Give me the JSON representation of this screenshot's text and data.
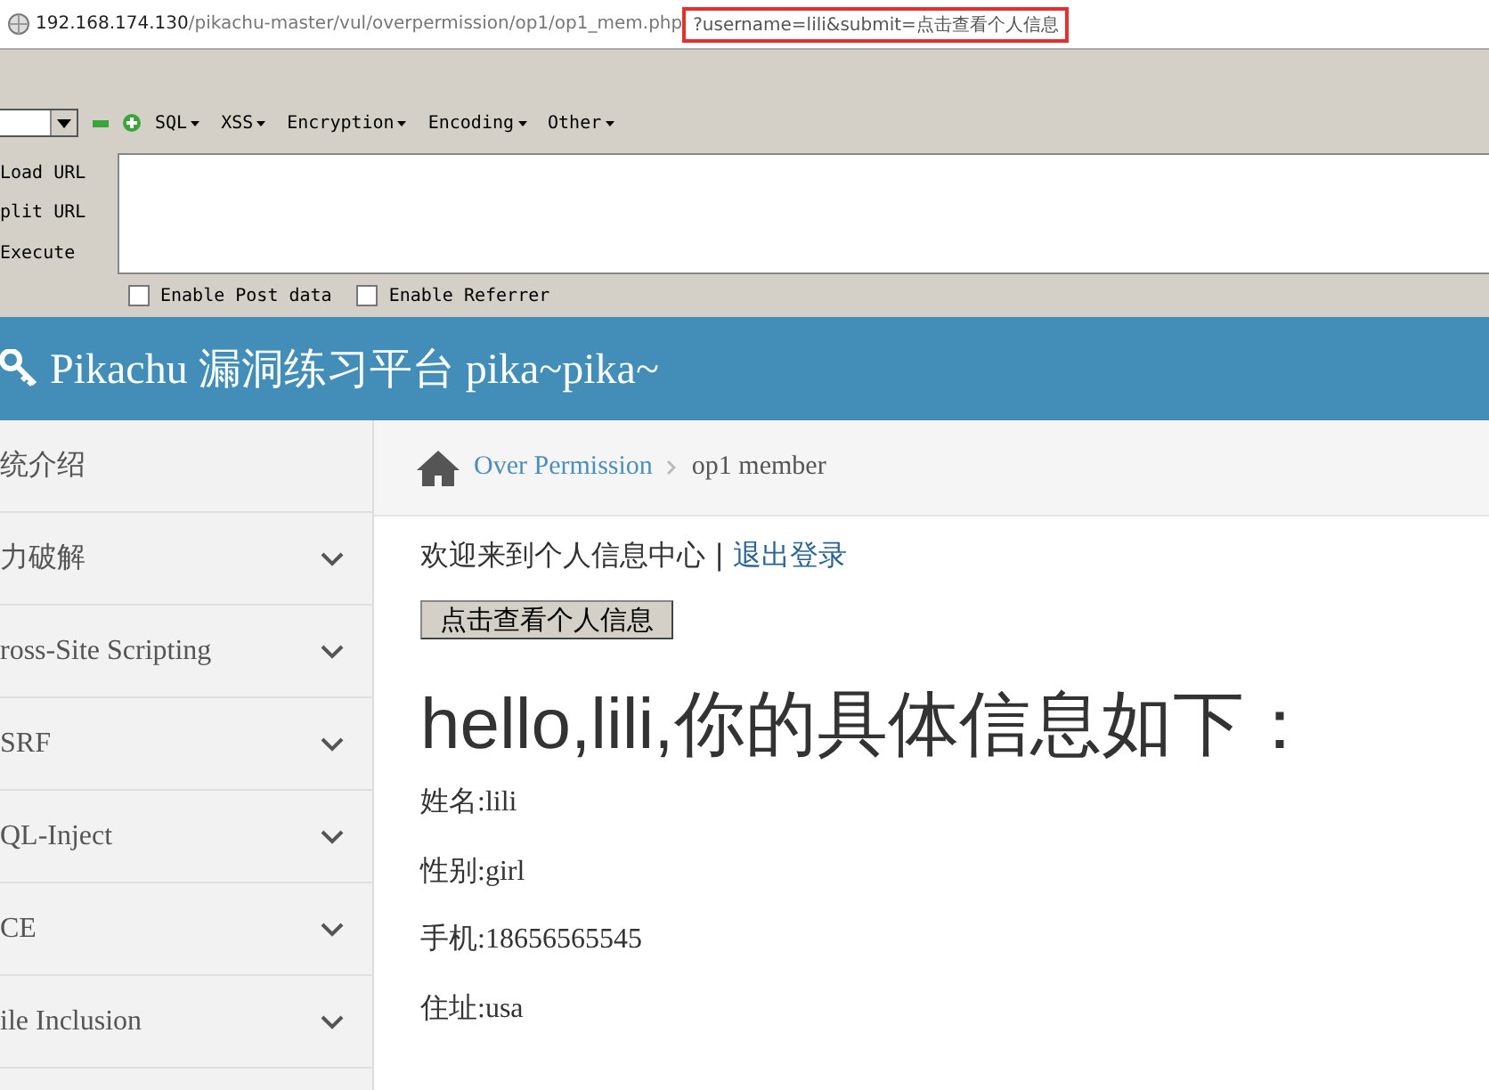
{
  "address_bar": {
    "host": "192.168.174.130",
    "path": "/pikachu-master/vul/overpermission/op1/op1_mem.php",
    "highlighted_query": "?username=lili&submit=点击查看个人信息"
  },
  "hackbar": {
    "menus": [
      {
        "label": "SQL"
      },
      {
        "label": "XSS"
      },
      {
        "label": "Encryption"
      },
      {
        "label": "Encoding"
      },
      {
        "label": "Other"
      }
    ],
    "actions": [
      "Load URL",
      "plit URL",
      "Execute"
    ],
    "options": [
      {
        "label": "Enable Post data",
        "checked": false
      },
      {
        "label": "Enable Referrer",
        "checked": false
      }
    ]
  },
  "header": {
    "title": "Pikachu 漏洞练习平台 pika~pika~"
  },
  "sidebar": {
    "items": [
      {
        "label": "统介绍",
        "expandable": false
      },
      {
        "label": "力破解",
        "expandable": true
      },
      {
        "label": "ross-Site Scripting",
        "expandable": true
      },
      {
        "label": "SRF",
        "expandable": true
      },
      {
        "label": "QL-Inject",
        "expandable": true
      },
      {
        "label": "CE",
        "expandable": true
      },
      {
        "label": "ile Inclusion",
        "expandable": true
      }
    ]
  },
  "breadcrumb": {
    "link": "Over Permission",
    "current": "op1 member"
  },
  "content": {
    "welcome": "欢迎来到个人信息中心",
    "separator": "|",
    "logout": "退出登录",
    "button": "点击查看个人信息",
    "heading": "hello,lili,你的具体信息如下：",
    "fields": [
      "姓名:lili",
      "性别:girl",
      "手机:18656565545",
      "住址:usa"
    ]
  }
}
